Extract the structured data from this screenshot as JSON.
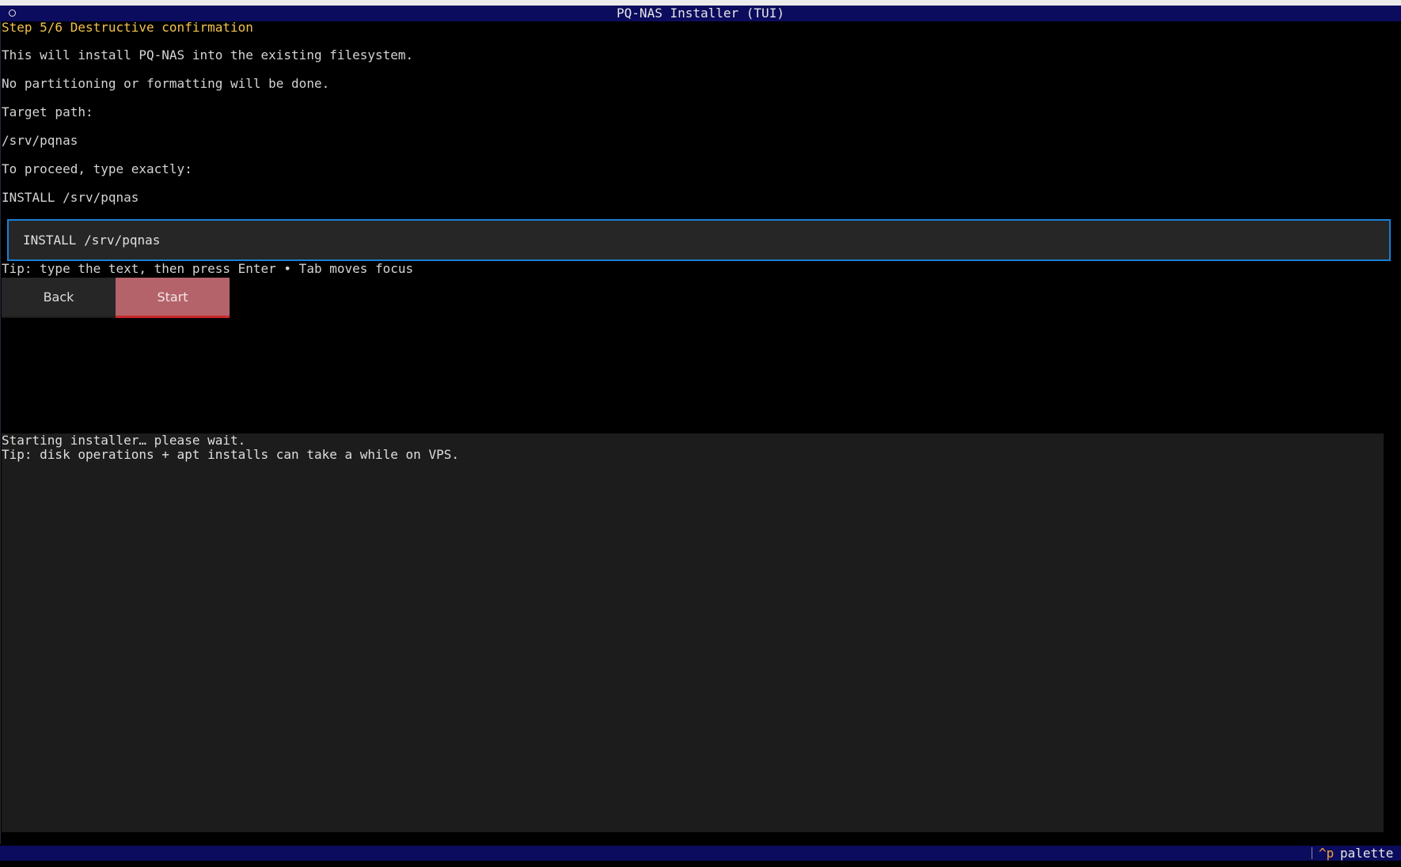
{
  "app": {
    "title": "PQ-NAS Installer (TUI)"
  },
  "step": {
    "heading": "Step 5/6 Destructive confirmation"
  },
  "body": {
    "line1": "This will install PQ-NAS into the existing filesystem.",
    "line2": "No partitioning or formatting will be done.",
    "target_label": "Target path:",
    "target_value": "/srv/pqnas",
    "proceed_label": "To proceed, type exactly:",
    "confirm_phrase": "INSTALL /srv/pqnas"
  },
  "input": {
    "value": "INSTALL /srv/pqnas",
    "tip": "Tip: type the text, then press Enter • Tab moves focus"
  },
  "buttons": {
    "back_label": "Back",
    "start_label": "Start"
  },
  "log": {
    "lines": [
      "Starting installer… please wait.",
      "Tip: disk operations + apt installs can take a while on VPS."
    ]
  },
  "statusbar": {
    "key": "^p",
    "action": "palette"
  },
  "colors": {
    "titlebar_bg": "#0c0c5e",
    "heading": "#f2c14e",
    "input_border": "#1a7fd4",
    "start_bg": "#b4636a",
    "start_underline": "#c62828",
    "key_highlight": "#f0a13c"
  }
}
